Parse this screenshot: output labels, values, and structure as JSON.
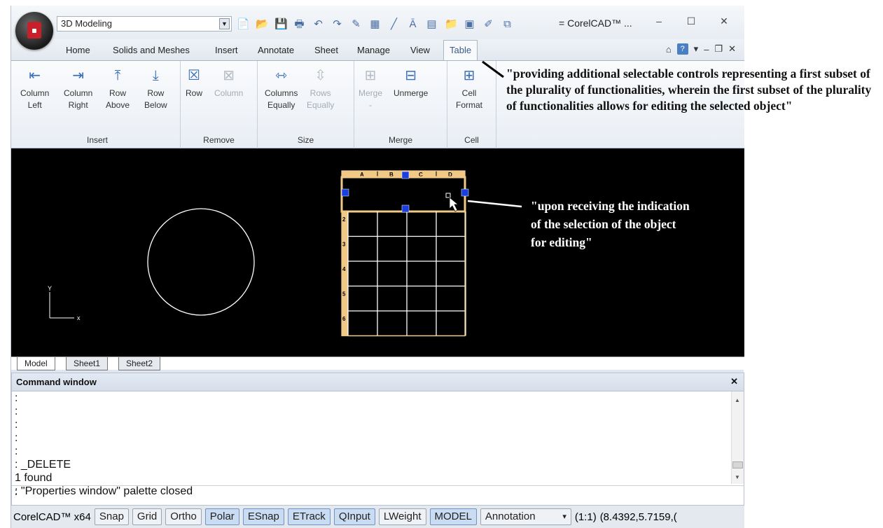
{
  "app": {
    "workspace": "3D Modeling",
    "title": "CorelCAD™ ...",
    "qat_icons": [
      "new-file-icon",
      "open-file-icon",
      "save-icon",
      "print-icon",
      "undo-icon",
      "redo-icon",
      "eraser-icon",
      "blueprint-icon",
      "line-icon",
      "text-icon",
      "calculator-icon",
      "folder-icon",
      "image-icon",
      "brush-icon",
      "layers-icon"
    ],
    "title_sep": "="
  },
  "tabs": [
    "Home",
    "Solids and Meshes",
    "Insert",
    "Annotate",
    "Sheet",
    "Manage",
    "View",
    "Table"
  ],
  "active_tab": "Table",
  "ribbon": {
    "groups": [
      {
        "label": "Insert",
        "buttons": [
          {
            "line1": "Column",
            "line2": "Left",
            "icon": "insert-column-left-icon",
            "enabled": true
          },
          {
            "line1": "Column",
            "line2": "Right",
            "icon": "insert-column-right-icon",
            "enabled": true
          },
          {
            "line1": "Row",
            "line2": "Above",
            "icon": "insert-row-above-icon",
            "enabled": true
          },
          {
            "line1": "Row",
            "line2": "Below",
            "icon": "insert-row-below-icon",
            "enabled": true
          }
        ]
      },
      {
        "label": "Remove",
        "buttons": [
          {
            "line1": "Row",
            "line2": "",
            "icon": "remove-row-icon",
            "enabled": true
          },
          {
            "line1": "Column",
            "line2": "",
            "icon": "remove-column-icon",
            "enabled": false
          }
        ]
      },
      {
        "label": "Size",
        "buttons": [
          {
            "line1": "Columns",
            "line2": "Equally",
            "icon": "columns-equally-icon",
            "enabled": true
          },
          {
            "line1": "Rows",
            "line2": "Equally",
            "icon": "rows-equally-icon",
            "enabled": false
          }
        ]
      },
      {
        "label": "Merge",
        "buttons": [
          {
            "line1": "Merge",
            "line2": "-",
            "icon": "merge-cells-icon",
            "enabled": false
          },
          {
            "line1": "Unmerge",
            "line2": "",
            "icon": "unmerge-cells-icon",
            "enabled": true
          }
        ]
      },
      {
        "label": "Cell",
        "buttons": [
          {
            "line1": "Cell",
            "line2": "Format",
            "icon": "cell-format-icon",
            "enabled": true
          }
        ]
      }
    ]
  },
  "canvas": {
    "table_cols": [
      "A",
      "B",
      "C",
      "D"
    ],
    "table_rows": [
      "2",
      "3",
      "4",
      "5",
      "6"
    ],
    "axis_x": "x",
    "axis_y": "Y"
  },
  "layout_tabs": [
    "Model",
    "Sheet1",
    "Sheet2"
  ],
  "active_layout": "Model",
  "command_window": {
    "title": "Command window",
    "lines": [
      ":",
      ":",
      ":",
      ":",
      ":",
      ": _DELETE",
      "1 found",
      ": \"Properties window\" palette closed"
    ],
    "input": ":"
  },
  "status_bar": {
    "app_label": "CorelCAD™ x64",
    "buttons": [
      {
        "label": "Snap",
        "on": false
      },
      {
        "label": "Grid",
        "on": false
      },
      {
        "label": "Ortho",
        "on": false
      },
      {
        "label": "Polar",
        "on": true
      },
      {
        "label": "ESnap",
        "on": true
      },
      {
        "label": "ETrack",
        "on": true
      },
      {
        "label": "QInput",
        "on": true
      },
      {
        "label": "LWeight",
        "on": false
      },
      {
        "label": "MODEL",
        "on": true
      }
    ],
    "annotation": "Annotation",
    "scale": "(1:1)",
    "coords": "(8.4392,5.7159,("
  },
  "annotations": {
    "top": "\"providing additional selectable controls representing a first subset of the plurality of functionalities, wherein the first subset of the plurality of functionalities allows for editing the selected object\"",
    "canvas": "\"upon receiving the indication of the selection of the object for editing\""
  }
}
